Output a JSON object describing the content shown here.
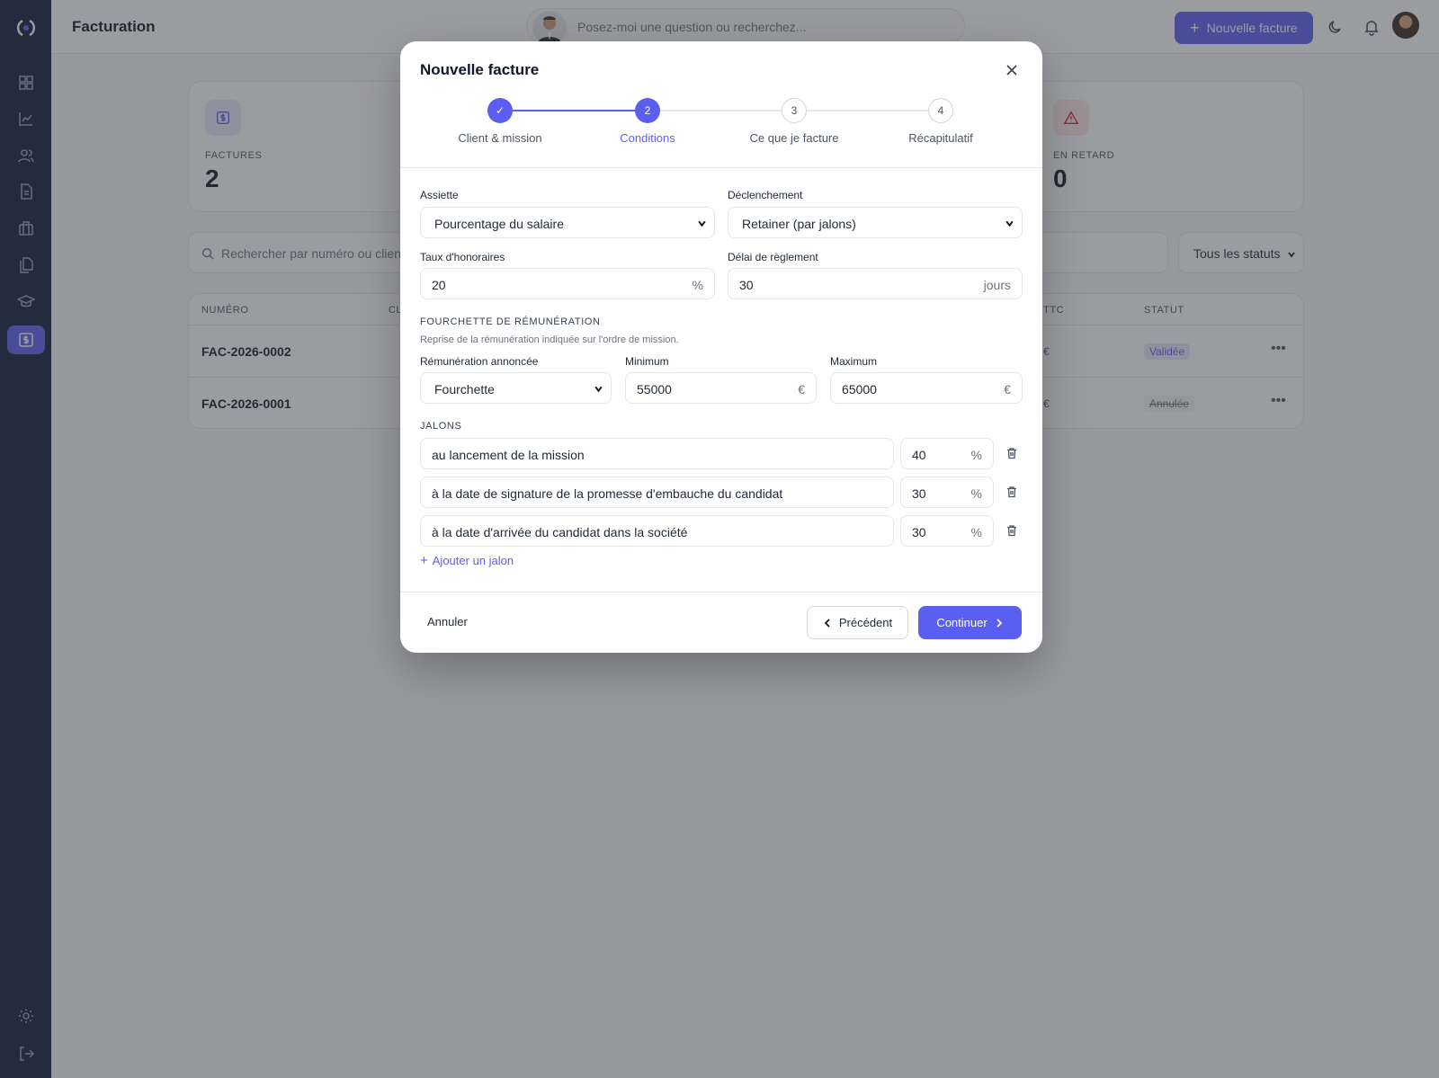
{
  "header": {
    "title": "Facturation",
    "ask_placeholder": "Posez-moi une question ou recherchez...",
    "new_invoice_label": "Nouvelle facture"
  },
  "sidebar": {
    "items": [
      {
        "icon": "dashboard-icon"
      },
      {
        "icon": "chart-icon"
      },
      {
        "icon": "users-icon"
      },
      {
        "icon": "document-icon"
      },
      {
        "icon": "briefcase-icon"
      },
      {
        "icon": "files-icon"
      },
      {
        "icon": "graduation-cap-icon"
      },
      {
        "icon": "invoice-icon",
        "active": true
      }
    ],
    "bottom": [
      {
        "icon": "gear-icon"
      },
      {
        "icon": "logout-icon"
      }
    ]
  },
  "stats": {
    "factures_label": "FACTURES",
    "factures_value": "2",
    "retard_label": "EN RETARD",
    "retard_value": "0"
  },
  "search": {
    "placeholder": "Rechercher par numéro ou client",
    "status_filter": "Tous les statuts"
  },
  "table": {
    "headers": {
      "numero": "NUMÉRO",
      "client": "CL",
      "ttc": "TTC",
      "statut": "STATUT"
    },
    "rows": [
      {
        "numero": "FAC-2026-0002",
        "ttc": "€",
        "statut": "Validée"
      },
      {
        "numero": "FAC-2026-0001",
        "ttc": "€",
        "statut": "Annulée"
      }
    ]
  },
  "modal": {
    "title": "Nouvelle facture",
    "steps": [
      {
        "num": "✓",
        "label": "Client & mission",
        "state": "done"
      },
      {
        "num": "2",
        "label": "Conditions",
        "state": "current"
      },
      {
        "num": "3",
        "label": "Ce que je facture",
        "state": "todo"
      },
      {
        "num": "4",
        "label": "Récapitulatif",
        "state": "todo"
      }
    ],
    "assiette": {
      "label": "Assiette",
      "value": "Pourcentage du salaire"
    },
    "declenchement": {
      "label": "Déclenchement",
      "value": "Retainer (par jalons)"
    },
    "taux": {
      "label": "Taux d'honoraires",
      "value": "20",
      "suffix": "%"
    },
    "delai": {
      "label": "Délai de règlement",
      "value": "30",
      "suffix": "jours"
    },
    "fourchette": {
      "title": "FOURCHETTE DE RÉMUNÉRATION",
      "desc": "Reprise de la rémunération indiquée sur l'ordre de mission.",
      "remuneration_label": "Rémunération annoncée",
      "remuneration_value": "Fourchette",
      "min_label": "Minimum",
      "min_value": "55000",
      "max_label": "Maximum",
      "max_value": "65000",
      "currency": "€"
    },
    "jalons": {
      "title": "JALONS",
      "items": [
        {
          "label": "au lancement de la mission",
          "percent": "40"
        },
        {
          "label": "à la date de signature de la promesse d'embauche du candidat",
          "percent": "30"
        },
        {
          "label": "à la date d'arrivée du candidat dans la société",
          "percent": "30"
        }
      ],
      "percent_suffix": "%",
      "add_label": "Ajouter un jalon"
    },
    "footer": {
      "cancel": "Annuler",
      "previous": "Précédent",
      "continue": "Continuer"
    }
  },
  "colors": {
    "accent": "#5b5ff0",
    "sidebar": "#0f1e3d",
    "danger": "#dc2626"
  }
}
